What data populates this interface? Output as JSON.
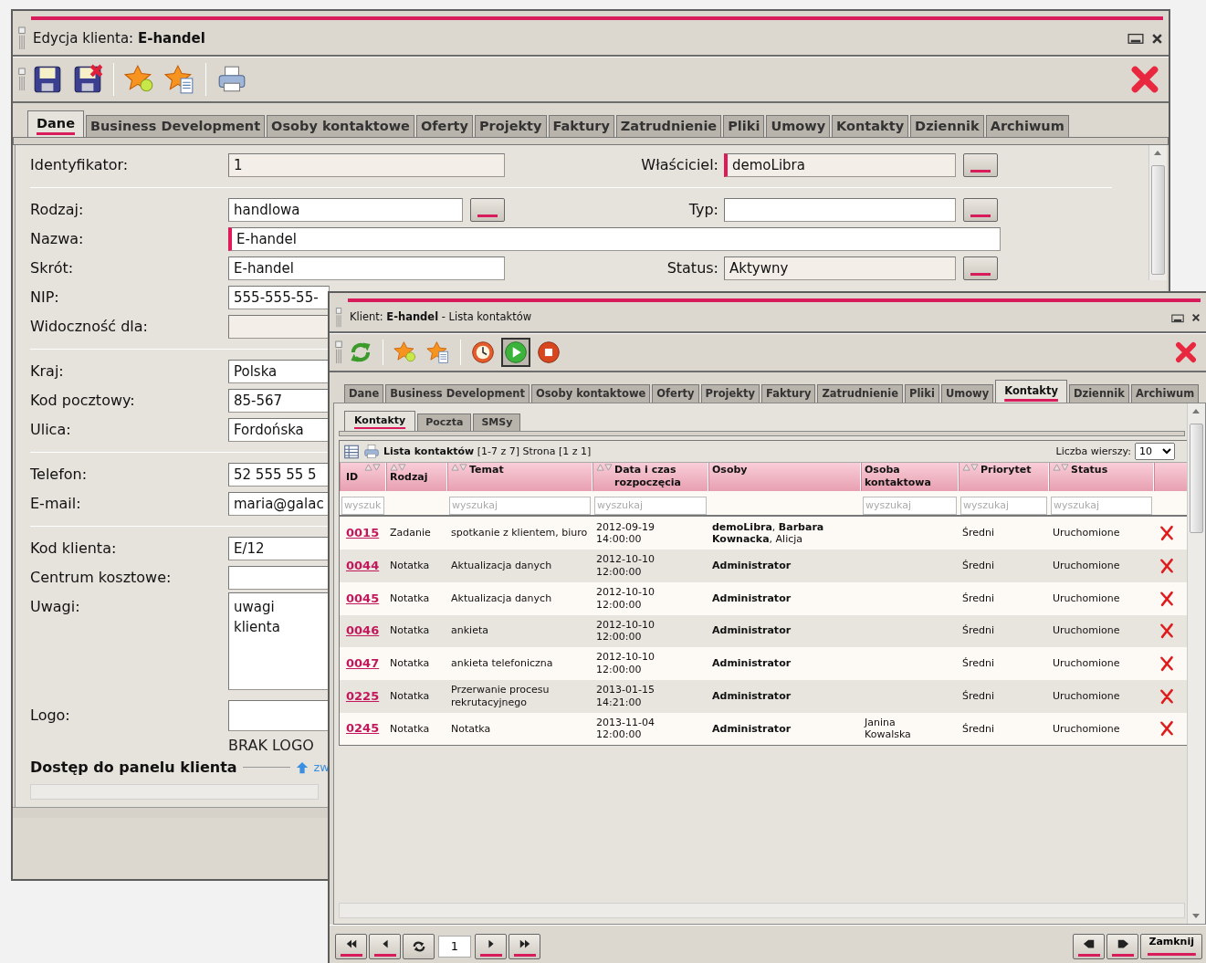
{
  "main_window": {
    "title": "Edycja klienta: **E-handel**",
    "toolbar": [
      {
        "kind": "save",
        "pressed": false
      },
      {
        "kind": "save_close",
        "pressed": false
      },
      {
        "kind": "separator"
      },
      {
        "kind": "star_bulb",
        "pressed": false
      },
      {
        "kind": "star_document",
        "pressed": false
      },
      {
        "kind": "separator"
      },
      {
        "kind": "print",
        "pressed": false
      },
      {
        "kind": "close",
        "pressed": false
      }
    ],
    "tabs": [
      {
        "label": "Dane",
        "selected": true
      },
      {
        "label": "Business Development",
        "selected": false
      },
      {
        "label": "Osoby kontaktowe",
        "selected": false
      },
      {
        "label": "Oferty",
        "selected": false
      },
      {
        "label": "Projekty",
        "selected": false
      },
      {
        "label": "Faktury",
        "selected": false
      },
      {
        "label": "Zatrudnienie",
        "selected": false
      },
      {
        "label": "Pliki",
        "selected": false
      },
      {
        "label": "Umowy",
        "selected": false
      },
      {
        "label": "Kontakty",
        "selected": false
      },
      {
        "label": "Dziennik",
        "selected": false
      },
      {
        "label": "Archiwum",
        "selected": false
      }
    ],
    "form": {
      "groups": [
        [
          {
            "label": "Identyfikator:",
            "field": {
              "kind": "text",
              "value": "1",
              "readonly": true,
              "required": false,
              "picker": false
            },
            "side": {
              "label": "Właściciel:",
              "value": "demoLibra",
              "readonly": true,
              "required": true,
              "picker": true
            }
          }
        ],
        [
          {
            "label": "Rodzaj:",
            "field": {
              "kind": "text",
              "value": "handlowa",
              "readonly": false,
              "required": false,
              "picker": true
            },
            "side": {
              "label": "Typ:",
              "readonly": false,
              "required": false,
              "picker": true
            }
          },
          {
            "label": "Nazwa:",
            "field": {
              "kind": "wide",
              "value": "E-handel",
              "readonly": false,
              "required": true,
              "picker": false
            }
          },
          {
            "label": "Skrót:",
            "field": {
              "kind": "text",
              "value": "E-handel",
              "readonly": false,
              "required": false,
              "picker": false
            },
            "side": {
              "label": "Status:",
              "value": "Aktywny",
              "readonly": true,
              "required": false,
              "picker": true
            }
          },
          {
            "label": "NIP:",
            "field": {
              "kind": "text",
              "value": "555-555-55-",
              "readonly": false,
              "required": false,
              "picker": false
            }
          },
          {
            "label": "Widoczność dla:",
            "field": {
              "kind": "text",
              "readonly": true,
              "required": false,
              "picker": false
            }
          }
        ],
        [
          {
            "label": "Kraj:",
            "field": {
              "kind": "text",
              "value": "Polska",
              "readonly": false,
              "required": false,
              "picker": false
            }
          },
          {
            "label": "Kod pocztowy:",
            "field": {
              "kind": "text",
              "value": "85-567",
              "readonly": false,
              "required": false,
              "picker": false
            }
          },
          {
            "label": "Ulica:",
            "field": {
              "kind": "text",
              "value": "Fordońska",
              "readonly": false,
              "required": false,
              "picker": false
            }
          }
        ],
        [
          {
            "label": "Telefon:",
            "field": {
              "kind": "text",
              "value": "52 555 55 5",
              "readonly": false,
              "required": false,
              "picker": false
            }
          },
          {
            "label": "E-mail:",
            "field": {
              "kind": "text",
              "value": "maria@galac",
              "readonly": false,
              "required": false,
              "picker": false
            }
          }
        ],
        [
          {
            "label": "Kod klienta:",
            "field": {
              "kind": "text",
              "value": "E/12",
              "readonly": false,
              "required": false,
              "picker": false
            }
          },
          {
            "label": "Centrum kosztowe:",
            "field": {
              "kind": "text",
              "readonly": false,
              "required": false,
              "picker": false
            }
          },
          {
            "label": "Uwagi:",
            "field": {
              "kind": "textarea",
              "value": "uwagi klienta",
              "readonly": false,
              "required": false,
              "picker": false
            }
          },
          {
            "label": "Logo:",
            "field": {
              "kind": "text",
              "readonly": false,
              "required": false,
              "picker": false
            }
          }
        ]
      ],
      "logo_note": "BRAK LOGO",
      "panel_access": {
        "title": "Dostęp do panelu klienta",
        "link": "zw"
      }
    }
  },
  "list_window": {
    "title": "Klient: **E-handel** - Lista kontaktów",
    "toolbar": [
      {
        "kind": "refresh",
        "pressed": false
      },
      {
        "kind": "separator"
      },
      {
        "kind": "star_bulb",
        "pressed": false
      },
      {
        "kind": "star_document",
        "pressed": false
      },
      {
        "kind": "separator"
      },
      {
        "kind": "clock",
        "pressed": false
      },
      {
        "kind": "play",
        "pressed": true
      },
      {
        "kind": "stop",
        "pressed": false
      },
      {
        "kind": "close",
        "pressed": false
      }
    ],
    "tabs": [
      {
        "label": "Dane",
        "selected": false
      },
      {
        "label": "Business Development",
        "selected": false
      },
      {
        "label": "Osoby kontaktowe",
        "selected": false
      },
      {
        "label": "Oferty",
        "selected": false
      },
      {
        "label": "Projekty",
        "selected": false
      },
      {
        "label": "Faktury",
        "selected": false
      },
      {
        "label": "Zatrudnienie",
        "selected": false
      },
      {
        "label": "Pliki",
        "selected": false
      },
      {
        "label": "Umowy",
        "selected": false
      },
      {
        "label": "Kontakty",
        "selected": true
      },
      {
        "label": "Dziennik",
        "selected": false
      },
      {
        "label": "Archiwum",
        "selected": false
      }
    ],
    "subtabs": [
      {
        "label": "Kontakty",
        "selected": true
      },
      {
        "label": "Poczta",
        "selected": false
      },
      {
        "label": "SMSy",
        "selected": false
      }
    ],
    "list": {
      "caption": "**Lista kontaktów** [1-7 z 7] Strona [1 z 1]",
      "rows_label": "Liczba wierszy:",
      "rows_value": "10",
      "columns": [
        {
          "label": "ID",
          "sortable": true
        },
        {
          "label": "Rodzaj",
          "sortable": true
        },
        {
          "label": "Temat",
          "sortable": true
        },
        {
          "label": "Data i czas rozpoczęcia",
          "sortable": true
        },
        {
          "label": "Osoby",
          "sortable": false
        },
        {
          "label": "Osoba kontaktowa",
          "sortable": false
        },
        {
          "label": "Priorytet",
          "sortable": true
        },
        {
          "label": "Status",
          "sortable": true
        }
      ],
      "filters": [
        {
          "kind": "search",
          "placeholder": "wyszuk"
        },
        {
          "kind": "none"
        },
        {
          "kind": "search",
          "placeholder": "wyszukaj"
        },
        {
          "kind": "search",
          "placeholder": "wyszukaj"
        },
        {
          "kind": "none"
        },
        {
          "kind": "search",
          "placeholder": "wyszukaj"
        },
        {
          "kind": "search",
          "placeholder": "wyszukaj"
        },
        {
          "kind": "search",
          "placeholder": "wyszukaj"
        }
      ],
      "rows": [
        {
          "id": "0015",
          "type": "Zadanie",
          "subject": "spotkanie z klientem, biuro",
          "start": "2012-09-19 14:00:00",
          "people": "**demoLibra**, **Barbara Kownacka**, Alicja",
          "priority": "Średni",
          "status": "Uruchomione"
        },
        {
          "id": "0044",
          "type": "Notatka",
          "subject": "Aktualizacja danych",
          "start": "2012-10-10 12:00:00",
          "people": "**Administrator**",
          "priority": "Średni",
          "status": "Uruchomione"
        },
        {
          "id": "0045",
          "type": "Notatka",
          "subject": "Aktualizacja danych",
          "start": "2012-10-10 12:00:00",
          "people": "**Administrator**",
          "priority": "Średni",
          "status": "Uruchomione"
        },
        {
          "id": "0046",
          "type": "Notatka",
          "subject": "ankieta",
          "start": "2012-10-10 12:00:00",
          "people": "**Administrator**",
          "priority": "Średni",
          "status": "Uruchomione"
        },
        {
          "id": "0047",
          "type": "Notatka",
          "subject": "ankieta telefoniczna",
          "start": "2012-10-10 12:00:00",
          "people": "**Administrator**",
          "priority": "Średni",
          "status": "Uruchomione"
        },
        {
          "id": "0225",
          "type": "Notatka",
          "subject": "Przerwanie procesu rekrutacyjnego",
          "start": "2013-01-15 14:21:00",
          "people": "**Administrator**",
          "priority": "Średni",
          "status": "Uruchomione"
        },
        {
          "id": "0245",
          "type": "Notatka",
          "subject": "Notatka",
          "start": "2013-11-04 12:00:00",
          "people": "**Administrator**",
          "contact": "Janina Kowalska",
          "priority": "Średni",
          "status": "Uruchomione"
        }
      ]
    },
    "pager": {
      "page": "1"
    },
    "close_label": "Zamknij"
  }
}
